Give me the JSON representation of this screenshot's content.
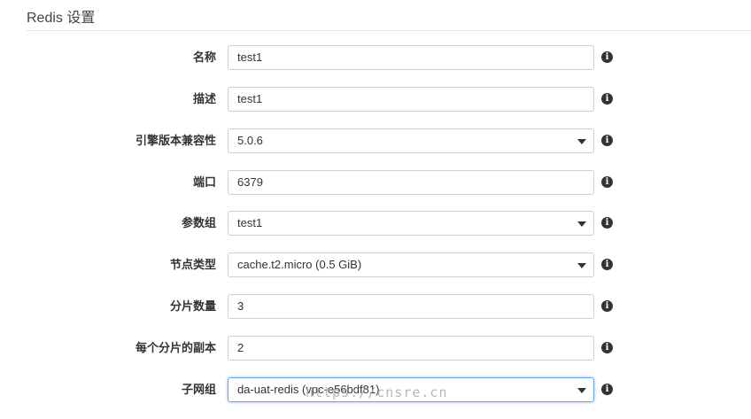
{
  "section": {
    "title": "Redis 设置"
  },
  "fields": [
    {
      "label": "名称",
      "value": "test1",
      "kind": "text"
    },
    {
      "label": "描述",
      "value": "test1",
      "kind": "text"
    },
    {
      "label": "引擎版本兼容性",
      "value": "5.0.6",
      "kind": "select"
    },
    {
      "label": "端口",
      "value": "6379",
      "kind": "text"
    },
    {
      "label": "参数组",
      "value": "test1",
      "kind": "select"
    },
    {
      "label": "节点类型",
      "value": "cache.t2.micro (0.5 GiB)",
      "kind": "select"
    },
    {
      "label": "分片数量",
      "value": "3",
      "kind": "text"
    },
    {
      "label": "每个分片的副本",
      "value": "2",
      "kind": "text"
    },
    {
      "label": "子网组",
      "value": "da-uat-redis (vpc-e56bdf81)",
      "kind": "select"
    }
  ],
  "icons": {
    "info": "info-icon",
    "dropdown": "chevron-down-icon"
  },
  "colors": {
    "focus_border": "#6aa5e8",
    "field_border": "#cfcfcf",
    "divider": "#e3e3e3"
  },
  "watermark": "https://cnsre.cn"
}
